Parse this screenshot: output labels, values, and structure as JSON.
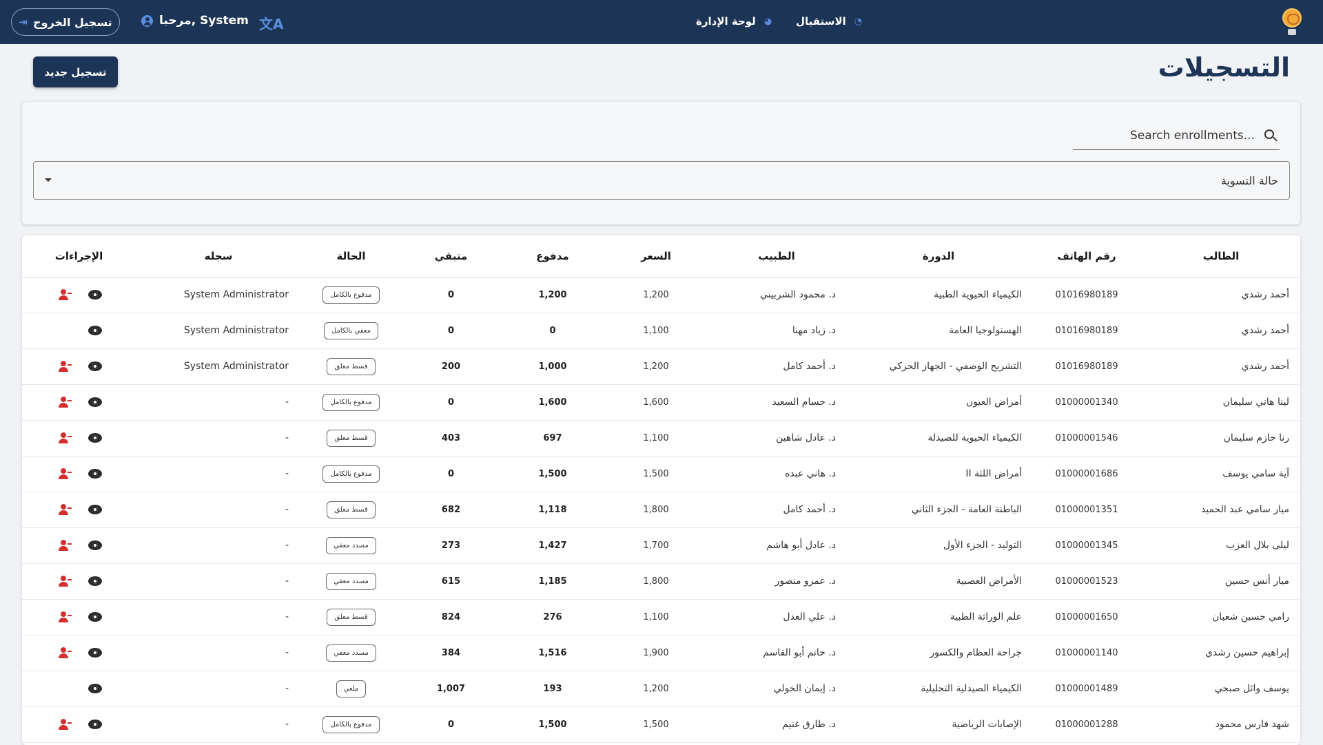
{
  "topbar": {
    "logout_label": "تسجيل الخروج",
    "welcome": "مرحبا, System",
    "nav_admin": "لوحة الإدارة",
    "nav_home": "الاستقبال"
  },
  "page": {
    "title": "التسجيلات",
    "new_button": "تسجيل جديد"
  },
  "filters": {
    "search_placeholder": "Search enrollments...",
    "status_select_label": "حالة التسوية"
  },
  "table": {
    "headers": {
      "student": "الطالب",
      "phone": "رقم الهاتف",
      "course": "الدورة",
      "doctor": "الطبيب",
      "price": "السعر",
      "paid": "مدفوع",
      "remaining": "متبقي",
      "status": "الحالة",
      "registered_by": "سجله",
      "actions": "الإجراءات"
    },
    "rows": [
      {
        "student": "أحمد رشدي",
        "phone": "01016980189",
        "course": "الكيمياء الحيوية الطبية",
        "doctor": "د. محمود الشربيني",
        "price": "1,200",
        "paid": "1,200",
        "remaining": "0",
        "status": "مدفوع بالكامل",
        "registered_by": "System Administrator",
        "can_remove": true
      },
      {
        "student": "أحمد رشدي",
        "phone": "01016980189",
        "course": "الهستولوجيا العامة",
        "doctor": "د. زياد مهنا",
        "price": "1,100",
        "paid": "0",
        "remaining": "0",
        "status": "معفي بالكامل",
        "registered_by": "System Administrator",
        "can_remove": false
      },
      {
        "student": "أحمد رشدي",
        "phone": "01016980189",
        "course": "التشريح الوصفي - الجهاز الحركي",
        "doctor": "د. أحمد كامل",
        "price": "1,200",
        "paid": "1,000",
        "remaining": "200",
        "status": "قسط معلق",
        "registered_by": "System Administrator",
        "can_remove": true
      },
      {
        "student": "لينا هاني سليمان",
        "phone": "01000001340",
        "course": "أمراض العيون",
        "doctor": "د. حسام السعيد",
        "price": "1,600",
        "paid": "1,600",
        "remaining": "0",
        "status": "مدفوع بالكامل",
        "registered_by": "-",
        "can_remove": true
      },
      {
        "student": "رنا حازم سليمان",
        "phone": "01000001546",
        "course": "الكيمياء الحيوية للصيدلة",
        "doctor": "د. عادل شاهين",
        "price": "1,100",
        "paid": "697",
        "remaining": "403",
        "status": "قسط معلق",
        "registered_by": "-",
        "can_remove": true
      },
      {
        "student": "آية سامي يوسف",
        "phone": "01000001686",
        "course": "أمراض اللثة II",
        "doctor": "د. هاني عبده",
        "price": "1,500",
        "paid": "1,500",
        "remaining": "0",
        "status": "مدفوع بالكامل",
        "registered_by": "-",
        "can_remove": true
      },
      {
        "student": "ميار سامي عبد الحميد",
        "phone": "01000001351",
        "course": "الباطنة العامة - الجزء الثاني",
        "doctor": "د. أحمد كامل",
        "price": "1,800",
        "paid": "1,118",
        "remaining": "682",
        "status": "قسط معلق",
        "registered_by": "-",
        "can_remove": true
      },
      {
        "student": "ليلى بلال العزب",
        "phone": "01000001345",
        "course": "التوليد - الجزء الأول",
        "doctor": "د. عادل أبو هاشم",
        "price": "1,700",
        "paid": "1,427",
        "remaining": "273",
        "status": "مسدد معفي",
        "registered_by": "-",
        "can_remove": true
      },
      {
        "student": "ميار أنس حسين",
        "phone": "01000001523",
        "course": "الأمراض العصبية",
        "doctor": "د. عمرو منصور",
        "price": "1,800",
        "paid": "1,185",
        "remaining": "615",
        "status": "مسدد معفي",
        "registered_by": "-",
        "can_remove": true
      },
      {
        "student": "رامي حسين شعبان",
        "phone": "01000001650",
        "course": "علم الوراثة الطبية",
        "doctor": "د. علي العدل",
        "price": "1,100",
        "paid": "276",
        "remaining": "824",
        "status": "قسط معلق",
        "registered_by": "-",
        "can_remove": true
      },
      {
        "student": "إبراهيم حسين رشدي",
        "phone": "01000001140",
        "course": "جراحة العظام والكسور",
        "doctor": "د. حاتم أبو القاسم",
        "price": "1,900",
        "paid": "1,516",
        "remaining": "384",
        "status": "مسدد معفي",
        "registered_by": "-",
        "can_remove": true
      },
      {
        "student": "يوسف وائل صبحي",
        "phone": "01000001489",
        "course": "الكيمياء الصيدلية التحليلية",
        "doctor": "د. إيمان الخولي",
        "price": "1,200",
        "paid": "193",
        "remaining": "1,007",
        "status": "ملغي",
        "registered_by": "-",
        "can_remove": false
      },
      {
        "student": "شهد فارس محمود",
        "phone": "01000001288",
        "course": "الإصابات الرياضية",
        "doctor": "د. طارق غنيم",
        "price": "1,500",
        "paid": "1,500",
        "remaining": "0",
        "status": "مدفوع بالكامل",
        "registered_by": "-",
        "can_remove": true
      }
    ]
  },
  "colors": {
    "navbar": "#1c3556",
    "accent_icon": "#5b8de0",
    "danger": "#d32f2f"
  }
}
